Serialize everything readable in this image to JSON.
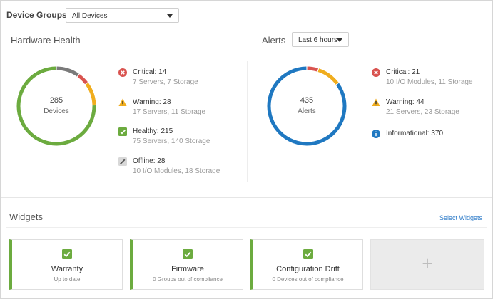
{
  "header": {
    "device_groups_label": "Device Groups",
    "device_groups_value": "All Devices"
  },
  "hardware_health": {
    "title": "Hardware Health",
    "center_count": "285",
    "center_label": "Devices",
    "items": [
      {
        "main": "Critical: 14",
        "sub": "7 Servers, 7 Storage",
        "icon": "critical-icon",
        "color": "#d9534f"
      },
      {
        "main": "Warning: 28",
        "sub": "17 Servers, 11 Storage",
        "icon": "warning-icon",
        "color": "#f0ad1e"
      },
      {
        "main": "Healthy: 215",
        "sub": "75 Servers, 140 Storage",
        "icon": "healthy-icon",
        "color": "#6cab3f"
      },
      {
        "main": "Offline: 28",
        "sub": "10 I/O Modules, 18 Storage",
        "icon": "offline-icon",
        "color": "#7a7a7a"
      }
    ]
  },
  "alerts": {
    "title": "Alerts",
    "range_value": "Last 6 hours",
    "center_count": "435",
    "center_label": "Alerts",
    "items": [
      {
        "main": "Critical: 21",
        "sub": "10 I/O Modules, 11 Storage",
        "icon": "critical-icon",
        "color": "#d9534f"
      },
      {
        "main": "Warning: 44",
        "sub": "21 Servers, 23 Storage",
        "icon": "warning-icon",
        "color": "#f0ad1e"
      },
      {
        "main": "Informational: 370",
        "sub": "",
        "icon": "info-icon",
        "color": "#1f78c1"
      }
    ]
  },
  "donut_segments": {
    "health": [
      {
        "value": 14,
        "color": "#d9534f"
      },
      {
        "value": 28,
        "color": "#f0ad1e"
      },
      {
        "value": 215,
        "color": "#6cab3f"
      },
      {
        "value": 28,
        "color": "#7a7a7a"
      }
    ],
    "alerts": [
      {
        "value": 21,
        "color": "#d9534f"
      },
      {
        "value": 44,
        "color": "#f0ad1e"
      },
      {
        "value": 370,
        "color": "#1f78c1"
      }
    ]
  },
  "widgets": {
    "title": "Widgets",
    "select_link": "Select Widgets",
    "cards": [
      {
        "title": "Warranty",
        "sub": "Up to date"
      },
      {
        "title": "Firmware",
        "sub": "0 Groups out of compliance"
      },
      {
        "title": "Configuration Drift",
        "sub": "0 Devices out of compliance"
      }
    ],
    "add_symbol": "+"
  }
}
